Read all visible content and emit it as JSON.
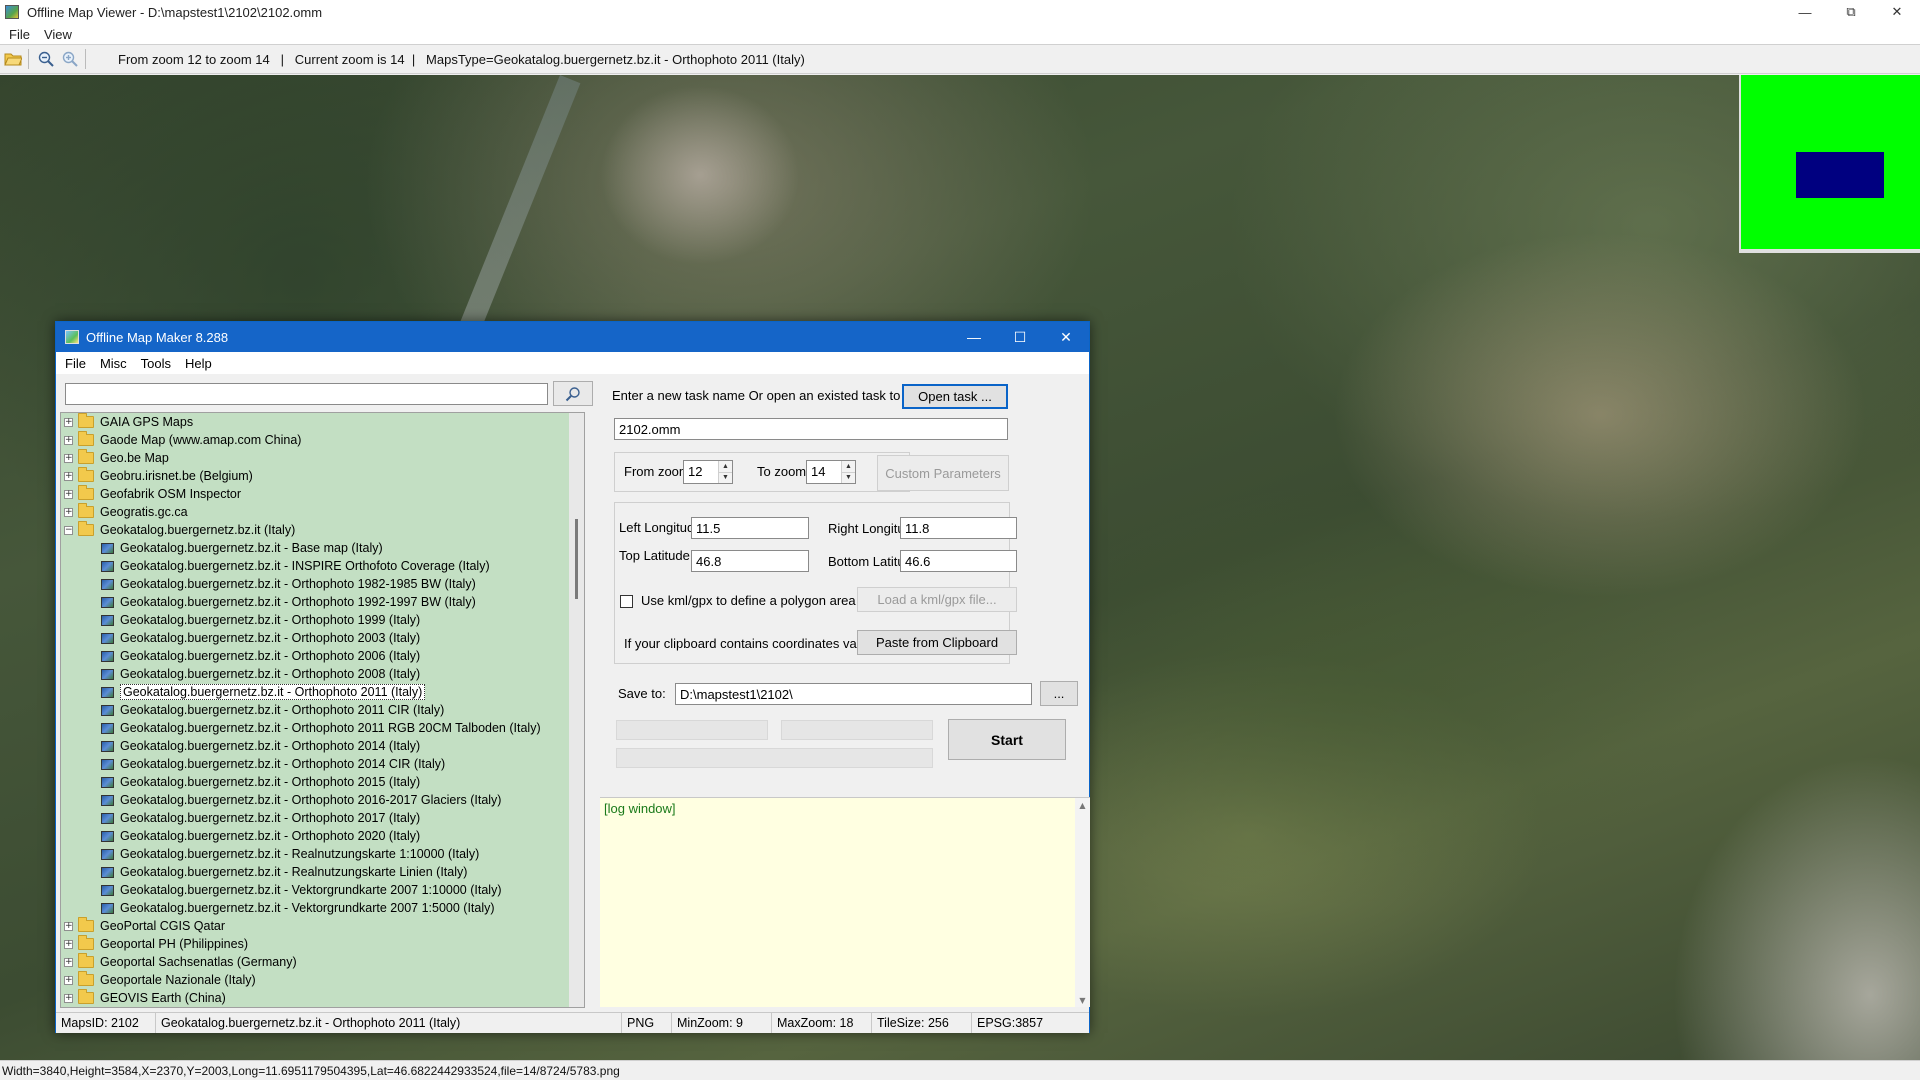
{
  "viewer": {
    "title": "Offline Map Viewer - D:\\mapstest1\\2102\\2102.omm",
    "menu": [
      "File",
      "View"
    ],
    "toolbar": {
      "status": "From zoom 12 to zoom 14   |   Current zoom is 14  |   MapsType=Geokatalog.buergernetz.bz.it - Orthophoto 2011 (Italy)"
    },
    "statusbar": "Width=3840,Height=3584,X=2370,Y=2003,Long=11.6951179504395,Lat=46.6822442933524,file=14/8724/5783.png",
    "colors": {
      "minimap_bg": "#00ff00",
      "minimap_viewport": "#000080"
    }
  },
  "maker": {
    "title": "Offline Map Maker 8.288",
    "menu": [
      "File",
      "Misc",
      "Tools",
      "Help"
    ],
    "search": {
      "value": "",
      "placeholder": ""
    },
    "tree": {
      "items": [
        {
          "label": "GAIA GPS Maps",
          "type": "folder",
          "expanded": false
        },
        {
          "label": "Gaode Map (www.amap.com China)",
          "type": "folder",
          "expanded": false
        },
        {
          "label": "Geo.be Map",
          "type": "folder",
          "expanded": false
        },
        {
          "label": "Geobru.irisnet.be (Belgium)",
          "type": "folder",
          "expanded": false
        },
        {
          "label": "Geofabrik OSM Inspector",
          "type": "folder",
          "expanded": false
        },
        {
          "label": "Geogratis.gc.ca",
          "type": "folder",
          "expanded": false
        },
        {
          "label": "Geokatalog.buergernetz.bz.it (Italy)",
          "type": "folder",
          "expanded": true
        },
        {
          "label": "Geokatalog.buergernetz.bz.it - Base map (Italy)",
          "type": "map"
        },
        {
          "label": "Geokatalog.buergernetz.bz.it - INSPIRE Orthofoto Coverage (Italy)",
          "type": "map"
        },
        {
          "label": "Geokatalog.buergernetz.bz.it - Orthophoto 1982-1985 BW (Italy)",
          "type": "map"
        },
        {
          "label": "Geokatalog.buergernetz.bz.it - Orthophoto 1992-1997 BW (Italy)",
          "type": "map"
        },
        {
          "label": "Geokatalog.buergernetz.bz.it - Orthophoto 1999 (Italy)",
          "type": "map"
        },
        {
          "label": "Geokatalog.buergernetz.bz.it - Orthophoto 2003 (Italy)",
          "type": "map"
        },
        {
          "label": "Geokatalog.buergernetz.bz.it - Orthophoto 2006 (Italy)",
          "type": "map"
        },
        {
          "label": "Geokatalog.buergernetz.bz.it - Orthophoto 2008 (Italy)",
          "type": "map"
        },
        {
          "label": "Geokatalog.buergernetz.bz.it - Orthophoto 2011 (Italy)",
          "type": "map",
          "selected": true
        },
        {
          "label": "Geokatalog.buergernetz.bz.it - Orthophoto 2011 CIR (Italy)",
          "type": "map"
        },
        {
          "label": "Geokatalog.buergernetz.bz.it - Orthophoto 2011 RGB 20CM Talboden (Italy)",
          "type": "map"
        },
        {
          "label": "Geokatalog.buergernetz.bz.it - Orthophoto 2014 (Italy)",
          "type": "map"
        },
        {
          "label": "Geokatalog.buergernetz.bz.it - Orthophoto 2014 CIR (Italy)",
          "type": "map"
        },
        {
          "label": "Geokatalog.buergernetz.bz.it - Orthophoto 2015 (Italy)",
          "type": "map"
        },
        {
          "label": "Geokatalog.buergernetz.bz.it - Orthophoto 2016-2017 Glaciers (Italy)",
          "type": "map"
        },
        {
          "label": "Geokatalog.buergernetz.bz.it - Orthophoto 2017 (Italy)",
          "type": "map"
        },
        {
          "label": "Geokatalog.buergernetz.bz.it - Orthophoto 2020 (Italy)",
          "type": "map"
        },
        {
          "label": "Geokatalog.buergernetz.bz.it - Realnutzungskarte 1:10000 (Italy)",
          "type": "map"
        },
        {
          "label": "Geokatalog.buergernetz.bz.it - Realnutzungskarte Linien (Italy)",
          "type": "map"
        },
        {
          "label": "Geokatalog.buergernetz.bz.it - Vektorgrundkarte 2007 1:10000 (Italy)",
          "type": "map"
        },
        {
          "label": "Geokatalog.buergernetz.bz.it - Vektorgrundkarte 2007 1:5000 (Italy)",
          "type": "map"
        },
        {
          "label": "GeoPortal CGIS Qatar",
          "type": "folder",
          "expanded": false
        },
        {
          "label": "Geoportal PH (Philippines)",
          "type": "folder",
          "expanded": false
        },
        {
          "label": "Geoportal Sachsenatlas (Germany)",
          "type": "folder",
          "expanded": false
        },
        {
          "label": "Geoportale Nazionale (Italy)",
          "type": "folder",
          "expanded": false
        },
        {
          "label": "GEOVIS Earth (China)",
          "type": "folder",
          "expanded": false
        }
      ]
    },
    "task": {
      "prompt": "Enter a new task name Or open an existed task to continue:",
      "open_label": "Open task ...",
      "name_value": "2102.omm"
    },
    "zoom": {
      "from_label": "From zoom",
      "from_value": "12",
      "to_label": "To zoom",
      "to_value": "14",
      "custom_label": "Custom Parameters"
    },
    "coords": {
      "left_lon_label": "Left Longitude",
      "left_lon": "11.5",
      "right_lon_label": "Right Longitude",
      "right_lon": "11.8",
      "top_lat_label": "Top Latitude",
      "top_lat": "46.8",
      "bottom_lat_label": "Bottom Latitude",
      "bottom_lat": "46.6",
      "kml_label": "Use kml/gpx to define a polygon area",
      "kml_checked": false,
      "load_kml_label": "Load a kml/gpx file...",
      "clipboard_label": "If your clipboard contains coordinates values:",
      "paste_label": "Paste from Clipboard"
    },
    "save": {
      "label": "Save to:",
      "path": "D:\\mapstest1\\2102\\",
      "browse_label": "..."
    },
    "start_label": "Start",
    "log_text": "[log window]",
    "statusbar": {
      "maps_id": "MapsID: 2102",
      "map_name": "Geokatalog.buergernetz.bz.it - Orthophoto 2011 (Italy)",
      "format": "PNG",
      "min_zoom": "MinZoom: 9",
      "max_zoom": "MaxZoom: 18",
      "tile_size": "TileSize: 256",
      "epsg": "EPSG:3857"
    }
  }
}
